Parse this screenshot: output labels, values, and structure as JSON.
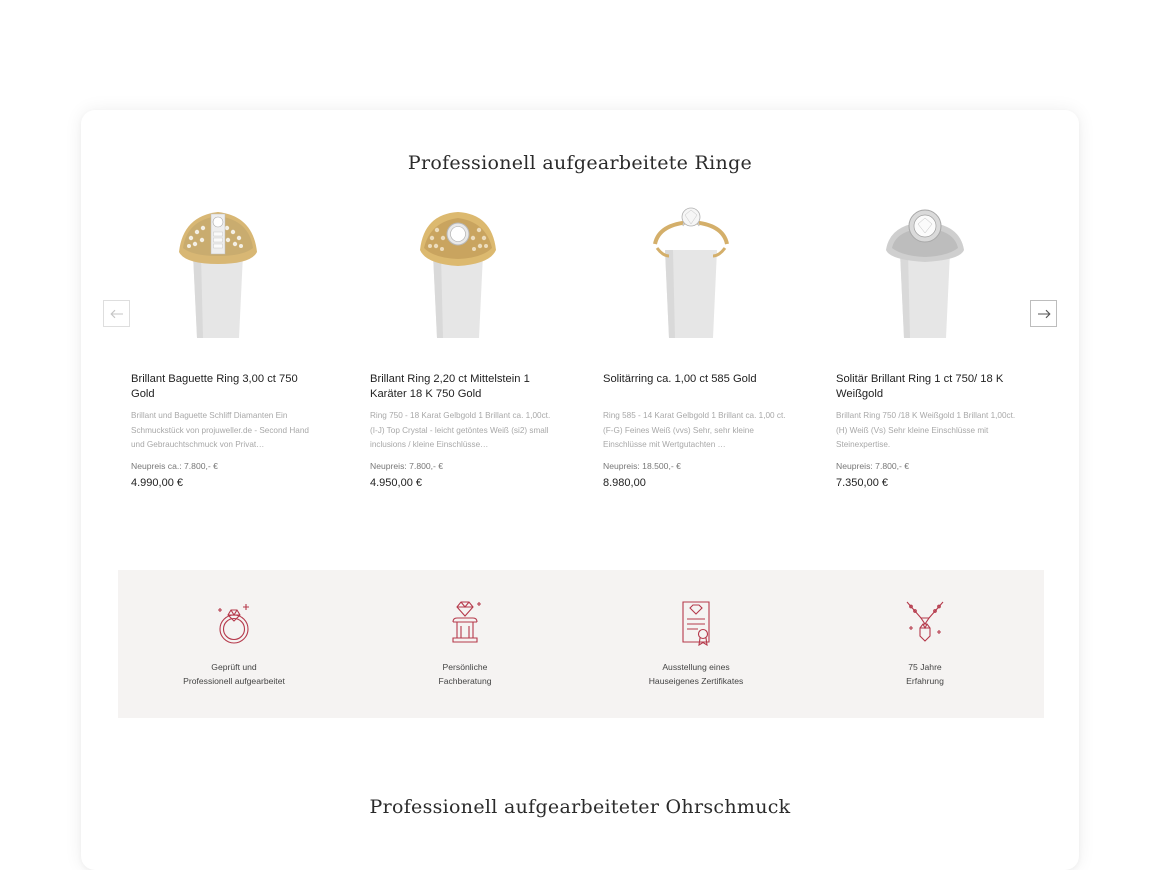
{
  "sections": {
    "rings_title": "Professionell aufgearbeitete Ringe",
    "earrings_title": "Professionell aufgearbeiteter Ohrschmuck"
  },
  "carousel": {
    "prev_icon": "arrow-left-icon",
    "next_icon": "arrow-right-icon"
  },
  "products": [
    {
      "name": "Brillant Baguette Ring 3,00 ct 750 Gold",
      "desc": "Brillant und Baguette Schliff Diamanten Ein Schmuckstück von projuweller.de - Second Hand und Gebrauchtschmuck von Privat…",
      "old_price": "Neupreis ca.: 7.800,- €",
      "price": "4.990,00 €",
      "metal": "yellow-white"
    },
    {
      "name": "Brillant Ring 2,20 ct Mittelstein 1 Karäter 18 K 750 Gold",
      "desc": "Ring 750 - 18 Karat Gelbgold 1 Brillant ca. 1,00ct. (I-J) Top Crystal - leicht getöntes Weiß (si2) small inclusions / kleine Einschlüsse…",
      "old_price": "Neupreis: 7.800,- €",
      "price": "4.950,00 €",
      "metal": "yellow"
    },
    {
      "name": "Solitärring ca. 1,00 ct 585 Gold",
      "desc": "Ring 585 - 14 Karat Gelbgold 1 Brillant ca. 1,00 ct. (F-G) Feines Weiß (vvs) Sehr, sehr kleine Einschlüsse mit Wertgutachten …",
      "old_price": "Neupreis: 18.500,- €",
      "price": "8.980,00",
      "metal": "yellow-thin"
    },
    {
      "name": "Solitär Brillant Ring 1 ct 750/ 18 K Weißgold",
      "desc": "Brillant Ring 750 /18 K Weißgold 1 Brillant 1,00ct. (H) Weiß (Vs) Sehr kleine Einschlüsse mit Steinexpertise.",
      "old_price": "Neupreis: 7.800,- €",
      "price": "7.350,00 €",
      "metal": "white"
    }
  ],
  "features": [
    {
      "icon": "ring-check-icon",
      "line1": "Geprüft und",
      "line2": "Professionell aufgearbeitet"
    },
    {
      "icon": "diamond-pedestal-icon",
      "line1": "Persönliche",
      "line2": "Fachberatung"
    },
    {
      "icon": "certificate-icon",
      "line1": "Ausstellung eines",
      "line2": "Hauseigenes Zertifikates"
    },
    {
      "icon": "necklace-icon",
      "line1": "75 Jahre",
      "line2": "Erfahrung"
    }
  ],
  "colors": {
    "accent": "#b5394b",
    "feature_bg": "#f5f3f2",
    "text": "#222222",
    "muted": "#a8a8a8",
    "gold": "#d9b46a",
    "white_gold": "#c9c9c9"
  }
}
